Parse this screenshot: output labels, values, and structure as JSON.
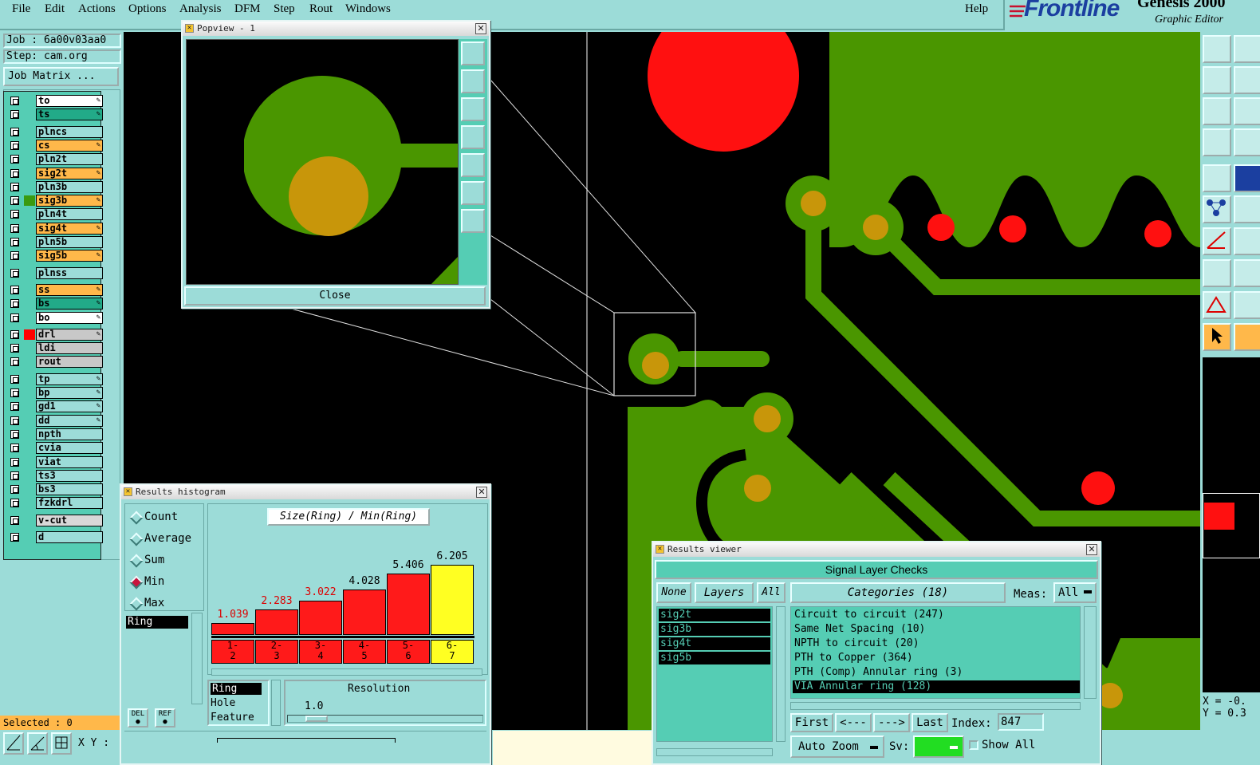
{
  "menubar": {
    "items": [
      "File",
      "Edit",
      "Actions",
      "Options",
      "Analysis",
      "DFM",
      "Step",
      "Rout",
      "Windows"
    ],
    "help": "Help",
    "brand": "Frontline",
    "product": "Genesis 2000",
    "subtitle": "Graphic Editor"
  },
  "job": {
    "job_line": "Job : 6a00v03aa0",
    "step_line": "Step: cam.org",
    "matrix_button": "Job Matrix ..."
  },
  "layers": [
    {
      "name": "to",
      "bg": "#ffffff",
      "color": null,
      "edit": true
    },
    {
      "name": "ts",
      "bg": "#22aa88",
      "color": null,
      "edit": true
    },
    {
      "name": "plncs",
      "bg": "#9cdcd8",
      "color": null,
      "edit": false
    },
    {
      "name": "cs",
      "bg": "#ffb84a",
      "color": null,
      "edit": true
    },
    {
      "name": "pln2t",
      "bg": "#9cdcd8",
      "color": null,
      "edit": false
    },
    {
      "name": "sig2t",
      "bg": "#ffb84a",
      "color": null,
      "edit": true
    },
    {
      "name": "pln3b",
      "bg": "#9cdcd8",
      "color": null,
      "edit": false
    },
    {
      "name": "sig3b",
      "bg": "#ffb84a",
      "color": "#3a9a10",
      "edit": true
    },
    {
      "name": "pln4t",
      "bg": "#9cdcd8",
      "color": null,
      "edit": false
    },
    {
      "name": "sig4t",
      "bg": "#ffb84a",
      "color": null,
      "edit": true
    },
    {
      "name": "pln5b",
      "bg": "#9cdcd8",
      "color": null,
      "edit": false
    },
    {
      "name": "sig5b",
      "bg": "#ffb84a",
      "color": null,
      "edit": true
    },
    {
      "name": "plnss",
      "bg": "#9cdcd8",
      "color": null,
      "edit": false
    },
    {
      "name": "ss",
      "bg": "#ffb84a",
      "color": null,
      "edit": true
    },
    {
      "name": "bs",
      "bg": "#22aa88",
      "color": null,
      "edit": true
    },
    {
      "name": "bo",
      "bg": "#ffffff",
      "color": null,
      "edit": true
    },
    {
      "name": "drl",
      "bg": "#c8c8c8",
      "color": "#ff0000",
      "edit": true
    },
    {
      "name": "ldi",
      "bg": "#c8c8c8",
      "color": null,
      "edit": false
    },
    {
      "name": "rout",
      "bg": "#c8c8c8",
      "color": null,
      "edit": false
    },
    {
      "name": "tp",
      "bg": "#9cdcd8",
      "color": null,
      "edit": true
    },
    {
      "name": "bp",
      "bg": "#9cdcd8",
      "color": null,
      "edit": true
    },
    {
      "name": "gd1",
      "bg": "#9cdcd8",
      "color": null,
      "edit": true
    },
    {
      "name": "dd",
      "bg": "#9cdcd8",
      "color": null,
      "edit": true
    },
    {
      "name": "npth",
      "bg": "#9cdcd8",
      "color": null,
      "edit": false
    },
    {
      "name": "cvia",
      "bg": "#9cdcd8",
      "color": null,
      "edit": false
    },
    {
      "name": "viat",
      "bg": "#9cdcd8",
      "color": null,
      "edit": false
    },
    {
      "name": "ts3",
      "bg": "#9cdcd8",
      "color": null,
      "edit": false
    },
    {
      "name": "bs3",
      "bg": "#9cdcd8",
      "color": null,
      "edit": false
    },
    {
      "name": "fzkdrl",
      "bg": "#9cdcd8",
      "color": null,
      "edit": false
    },
    {
      "name": "v-cut",
      "bg": "#d8d8d8",
      "color": null,
      "edit": false
    },
    {
      "name": "d",
      "bg": "#9cdcd8",
      "color": null,
      "edit": false
    }
  ],
  "status": {
    "selected": "Selected : 0",
    "xy_label": "X Y :",
    "coords_x": "X = -0.",
    "coords_y": "Y = 0.3"
  },
  "popview": {
    "title": "Popview - 1",
    "close": "Close"
  },
  "histogram": {
    "title": "Results histogram",
    "options": [
      {
        "label": "Count",
        "selected": false
      },
      {
        "label": "Average",
        "selected": false
      },
      {
        "label": "Sum",
        "selected": false
      },
      {
        "label": "Min",
        "selected": true
      },
      {
        "label": "Max",
        "selected": false
      }
    ],
    "selected_measure": "Ring",
    "heading": "Size(Ring) / Min(Ring)",
    "bars": [
      {
        "range": "1-\n2",
        "value": "1.039",
        "v": 1.039,
        "highlight": false
      },
      {
        "range": "2-\n3",
        "value": "2.283",
        "v": 2.283,
        "highlight": false
      },
      {
        "range": "3-\n4",
        "value": "3.022",
        "v": 3.022,
        "highlight": false
      },
      {
        "range": "4-\n5",
        "value": "4.028",
        "v": 4.028,
        "highlight": false
      },
      {
        "range": "5-\n6",
        "value": "5.406",
        "v": 5.406,
        "highlight": false
      },
      {
        "range": "6-\n7",
        "value": "6.205",
        "v": 6.205,
        "highlight": true
      }
    ],
    "measures": [
      "Ring",
      "Hole",
      "Feature"
    ],
    "resolution_label": "Resolution",
    "resolution_value": "1.0",
    "del": "DEL",
    "ref": "REF"
  },
  "results_viewer": {
    "title": "Results viewer",
    "heading": "Signal Layer Checks",
    "none": "None",
    "layers": "Layers",
    "all": "All",
    "categories": "Categories (18)",
    "meas_label": "Meas:",
    "meas_value": "All",
    "layer_list": [
      "sig2t",
      "sig3b",
      "sig4t",
      "sig5b"
    ],
    "category_list": [
      {
        "label": "Circuit to circuit (247)",
        "selected": false
      },
      {
        "label": "Same Net Spacing (10)",
        "selected": false
      },
      {
        "label": "NPTH to circuit (20)",
        "selected": false
      },
      {
        "label": "PTH to Copper (364)",
        "selected": false
      },
      {
        "label": "PTH (Comp) Annular ring (3)",
        "selected": false
      },
      {
        "label": "VIA Annular ring (128)",
        "selected": true
      }
    ],
    "first": "First",
    "prev": "<---",
    "next": "--->",
    "last": "Last",
    "index_label": "Index:",
    "index_value": "847",
    "auto_zoom": "Auto Zoom",
    "sv_label": "Sv:",
    "show_all": "Show All"
  }
}
